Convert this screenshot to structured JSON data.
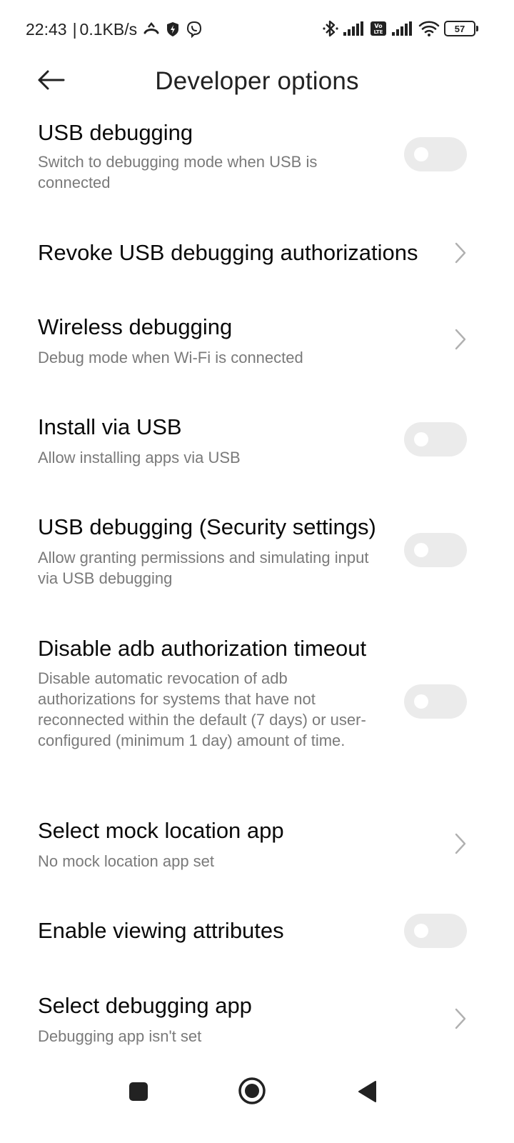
{
  "status_bar": {
    "time": "22:43",
    "separator": "|",
    "speed": "0.1KB/s",
    "battery": "57"
  },
  "header": {
    "title": "Developer options"
  },
  "settings": [
    {
      "title": "USB debugging",
      "subtitle": "Switch to debugging mode when USB is connected",
      "control": "toggle",
      "on": false
    },
    {
      "title": "Revoke USB debugging authorizations",
      "subtitle": "",
      "control": "chevron"
    },
    {
      "title": "Wireless debugging",
      "subtitle": "Debug mode when Wi-Fi is connected",
      "control": "chevron"
    },
    {
      "title": "Install via USB",
      "subtitle": "Allow installing apps via USB",
      "control": "toggle",
      "on": false
    },
    {
      "title": "USB debugging (Security settings)",
      "subtitle": "Allow granting permissions and simulating input via USB debugging",
      "control": "toggle",
      "on": false
    },
    {
      "title": "Disable adb authorization timeout",
      "subtitle": "Disable automatic revocation of adb authorizations for systems that have not reconnected within the default (7 days) or user-configured (minimum 1 day) amount of time.",
      "control": "toggle",
      "on": false
    },
    {
      "title": "Select mock location app",
      "subtitle": "No mock location app set",
      "control": "chevron"
    },
    {
      "title": "Enable viewing attributes",
      "subtitle": "",
      "control": "toggle",
      "on": false
    },
    {
      "title": "Select debugging app",
      "subtitle": "Debugging app isn't set",
      "control": "chevron"
    }
  ],
  "nav_bar": {
    "icons": [
      "recents-square-icon",
      "home-circle-icon",
      "back-triangle-icon"
    ]
  },
  "colors": {
    "toggle_off": "#ebebeb",
    "subtitle": "#7a7a7a",
    "chevron": "#b0b0b0"
  }
}
